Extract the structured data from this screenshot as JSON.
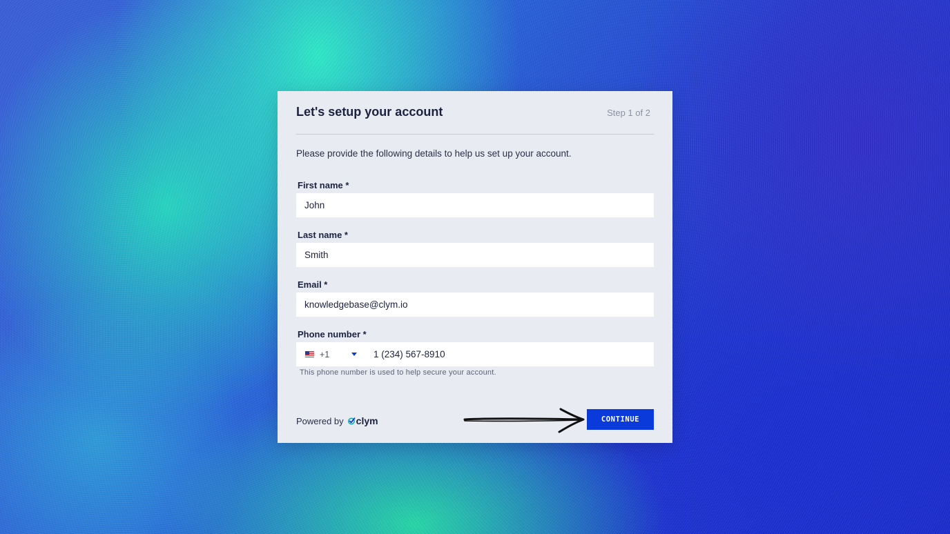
{
  "card": {
    "title": "Let's setup your account",
    "step": "Step 1 of 2",
    "intro": "Please provide the following details to help us set up your account."
  },
  "form": {
    "first_name": {
      "label": "First name *",
      "value": "John"
    },
    "last_name": {
      "label": "Last name *",
      "value": "Smith"
    },
    "email": {
      "label": "Email *",
      "value": "knowledgebase@clym.io"
    },
    "phone": {
      "label": "Phone number *",
      "country_flag": "us-flag-icon",
      "country_code": "+1",
      "value": "1 (234) 567-8910",
      "helper": "This phone number is used to help secure your account."
    }
  },
  "footer": {
    "powered_by": "Powered by",
    "brand": "clym",
    "continue_label": "CONTINUE"
  },
  "colors": {
    "accent": "#0a3ad9",
    "card_bg": "#e8ebf2",
    "title": "#1b2240"
  }
}
